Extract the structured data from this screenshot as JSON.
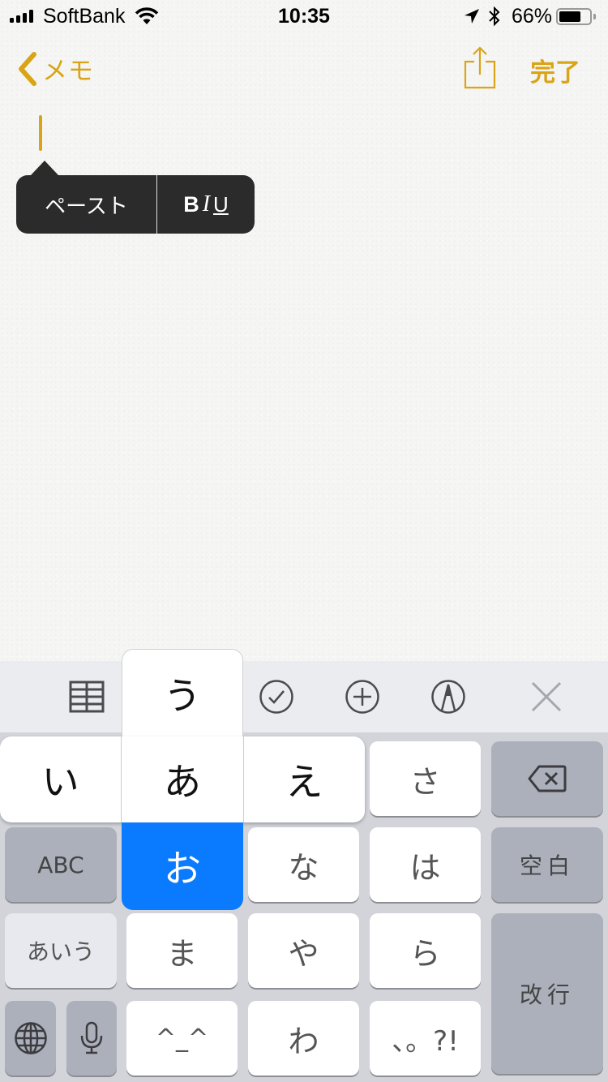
{
  "status_bar": {
    "carrier": "SoftBank",
    "time": "10:35",
    "battery_percent": "66%",
    "battery_level": 0.66,
    "signal_bars": 4,
    "icons": [
      "signal-icon",
      "wifi-icon",
      "location-arrow-icon",
      "bluetooth-icon",
      "battery-icon"
    ]
  },
  "nav": {
    "back_label": "メモ",
    "done_label": "完了",
    "share_icon": "share-icon",
    "accent_color": "#d9a517"
  },
  "note": {
    "text": ""
  },
  "edit_menu": {
    "paste_label": "ペースト",
    "bold_label": "B",
    "italic_label": "I",
    "underline_label": "U"
  },
  "keyboard_toolbar": {
    "icons": [
      "table-icon",
      "checklist-icon",
      "add-icon",
      "markup-icon",
      "close-icon"
    ]
  },
  "flick_popup": {
    "center": "あ",
    "up": "う",
    "left": "い",
    "right": "え",
    "down": "お",
    "selected": "お",
    "selected_color": "#0a7aff"
  },
  "keyboard": {
    "row1": {
      "sa": "さ",
      "delete_icon": "delete-icon"
    },
    "row2": {
      "abc": "ABC",
      "na": "な",
      "ha": "は",
      "space": "空白"
    },
    "row3": {
      "aiu": "あいう",
      "ma": "ま",
      "ya": "や",
      "ra": "ら",
      "return": "改行"
    },
    "row4": {
      "globe_icon": "globe-icon",
      "mic_icon": "microphone-icon",
      "kaomoji": "^_^",
      "wa": "わ",
      "punct": "、。?!"
    }
  }
}
